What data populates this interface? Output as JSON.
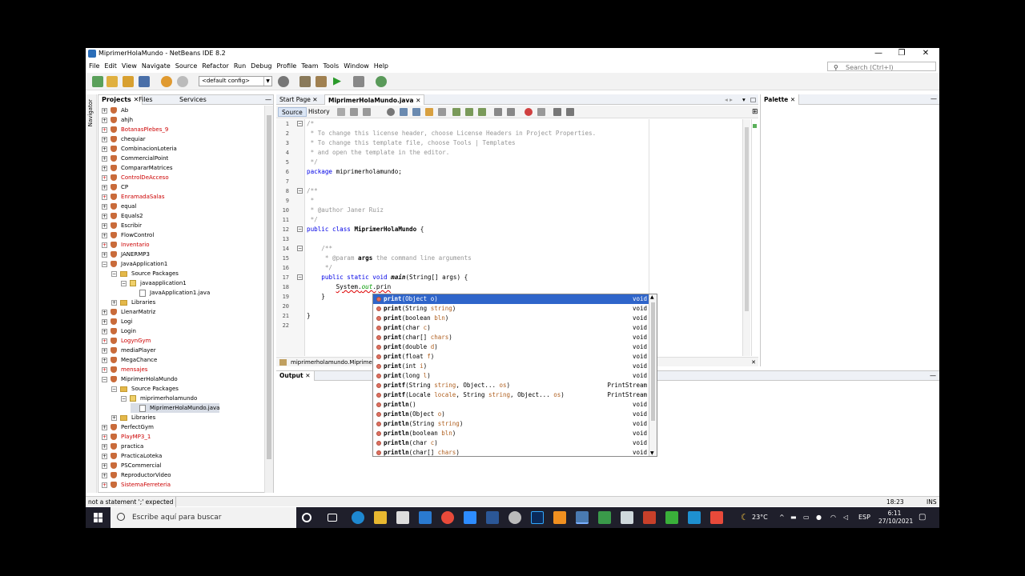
{
  "window": {
    "title": "MiprimerHolaMundo - NetBeans IDE 8.2",
    "minimize": "—",
    "maximize": "❐",
    "close": "✕"
  },
  "menu": [
    "File",
    "Edit",
    "View",
    "Navigate",
    "Source",
    "Refactor",
    "Run",
    "Debug",
    "Profile",
    "Team",
    "Tools",
    "Window",
    "Help"
  ],
  "search": {
    "placeholder": "Search (Ctrl+I)"
  },
  "toolbar": {
    "config": "<default config>"
  },
  "navigator": {
    "label": "Navigator"
  },
  "projects_panel": {
    "tabs": [
      "Projects",
      "Files",
      "Services"
    ],
    "tree": [
      {
        "label": "Ab",
        "level": 0,
        "kind": "project",
        "exp": "+",
        "error": false
      },
      {
        "label": "ahjh",
        "level": 0,
        "kind": "project",
        "exp": "+",
        "error": false
      },
      {
        "label": "BotanasPlebes_9",
        "level": 0,
        "kind": "project",
        "exp": "+",
        "error": true
      },
      {
        "label": "chequiar",
        "level": 0,
        "kind": "project",
        "exp": "+",
        "error": false
      },
      {
        "label": "CombinacionLoteria",
        "level": 0,
        "kind": "project",
        "exp": "+",
        "error": false
      },
      {
        "label": "CommercialPoint",
        "level": 0,
        "kind": "project",
        "exp": "+",
        "error": false
      },
      {
        "label": "CompararMatrices",
        "level": 0,
        "kind": "project",
        "exp": "+",
        "error": false
      },
      {
        "label": "ControlDeAcceso",
        "level": 0,
        "kind": "project",
        "exp": "+",
        "error": true
      },
      {
        "label": "CP",
        "level": 0,
        "kind": "project",
        "exp": "+",
        "error": false
      },
      {
        "label": "EnramadaSalas",
        "level": 0,
        "kind": "project",
        "exp": "+",
        "error": true
      },
      {
        "label": "equal",
        "level": 0,
        "kind": "project",
        "exp": "+",
        "error": false
      },
      {
        "label": "Equals2",
        "level": 0,
        "kind": "project",
        "exp": "+",
        "error": false
      },
      {
        "label": "Escribir",
        "level": 0,
        "kind": "project",
        "exp": "+",
        "error": false
      },
      {
        "label": "FlowControl",
        "level": 0,
        "kind": "project",
        "exp": "+",
        "error": false
      },
      {
        "label": "Inventario",
        "level": 0,
        "kind": "project",
        "exp": "+",
        "error": true
      },
      {
        "label": "JANERMP3",
        "level": 0,
        "kind": "project",
        "exp": "+",
        "error": false
      },
      {
        "label": "JavaApplication1",
        "level": 0,
        "kind": "project",
        "exp": "−",
        "error": false
      },
      {
        "label": "Source Packages",
        "level": 1,
        "kind": "folder",
        "exp": "−",
        "error": false
      },
      {
        "label": "javaapplication1",
        "level": 2,
        "kind": "package",
        "exp": "−",
        "error": false
      },
      {
        "label": "JavaApplication1.java",
        "level": 3,
        "kind": "file",
        "exp": "",
        "error": false
      },
      {
        "label": "Libraries",
        "level": 1,
        "kind": "folder",
        "exp": "+",
        "error": false
      },
      {
        "label": "LlenarMatriz",
        "level": 0,
        "kind": "project",
        "exp": "+",
        "error": false
      },
      {
        "label": "Logi",
        "level": 0,
        "kind": "project",
        "exp": "+",
        "error": false
      },
      {
        "label": "Login",
        "level": 0,
        "kind": "project",
        "exp": "+",
        "error": false
      },
      {
        "label": "LogynGym",
        "level": 0,
        "kind": "project",
        "exp": "+",
        "error": true
      },
      {
        "label": "mediaPlayer",
        "level": 0,
        "kind": "project",
        "exp": "+",
        "error": false
      },
      {
        "label": "MegaChance",
        "level": 0,
        "kind": "project",
        "exp": "+",
        "error": false
      },
      {
        "label": "mensajes",
        "level": 0,
        "kind": "project",
        "exp": "+",
        "error": true
      },
      {
        "label": "MiprimerHolaMundo",
        "level": 0,
        "kind": "project",
        "exp": "−",
        "error": false
      },
      {
        "label": "Source Packages",
        "level": 1,
        "kind": "folder",
        "exp": "−",
        "error": false
      },
      {
        "label": "miprimerholamundo",
        "level": 2,
        "kind": "package",
        "exp": "−",
        "error": false
      },
      {
        "label": "MiprimerHolaMundo.java",
        "level": 3,
        "kind": "file",
        "exp": "",
        "error": false,
        "selected": true
      },
      {
        "label": "Libraries",
        "level": 1,
        "kind": "folder",
        "exp": "+",
        "error": false
      },
      {
        "label": "PerfectGym",
        "level": 0,
        "kind": "project",
        "exp": "+",
        "error": false
      },
      {
        "label": "PlayMP3_1",
        "level": 0,
        "kind": "project",
        "exp": "+",
        "error": true
      },
      {
        "label": "practica",
        "level": 0,
        "kind": "project",
        "exp": "+",
        "error": false
      },
      {
        "label": "PracticaLoteka",
        "level": 0,
        "kind": "project",
        "exp": "+",
        "error": false
      },
      {
        "label": "PSCommercial",
        "level": 0,
        "kind": "project",
        "exp": "+",
        "error": false
      },
      {
        "label": "ReproductorVideo",
        "level": 0,
        "kind": "project",
        "exp": "+",
        "error": false
      },
      {
        "label": "SistemaFerreteria",
        "level": 0,
        "kind": "project",
        "exp": "+",
        "error": true
      }
    ]
  },
  "editor": {
    "tabs": [
      "Start Page",
      "MiprimerHolaMundo.java"
    ],
    "source_btn": "Source",
    "history_btn": "History",
    "breadcrumb": "miprimerholamundo.MiprimerHol",
    "lines": [
      {
        "n": "1",
        "html": "<span class='cm'>/*</span>"
      },
      {
        "n": "2",
        "html": "<span class='cm'> * To change this license header, choose License Headers in Project Properties.</span>"
      },
      {
        "n": "3",
        "html": "<span class='cm'> * To change this template file, choose Tools | Templates</span>"
      },
      {
        "n": "4",
        "html": "<span class='cm'> * and open the template in the editor.</span>"
      },
      {
        "n": "5",
        "html": "<span class='cm'> */</span>"
      },
      {
        "n": "6",
        "html": "<span class='kw'>package</span> miprimerholamundo;"
      },
      {
        "n": "7",
        "html": ""
      },
      {
        "n": "8",
        "html": "<span class='cm'>/**</span>"
      },
      {
        "n": "9",
        "html": "<span class='cm'> *</span>"
      },
      {
        "n": "10",
        "html": "<span class='cm'> * @author Janer Ruiz</span>"
      },
      {
        "n": "11",
        "html": "<span class='cm'> */</span>"
      },
      {
        "n": "12",
        "html": "<span class='kw'>public class</span> <b>MiprimerHolaMundo</b> {"
      },
      {
        "n": "13",
        "html": ""
      },
      {
        "n": "14",
        "html": "    <span class='cm'>/**</span>"
      },
      {
        "n": "15",
        "html": "<span class='cm'>     * @param </span><b>args</b><span class='cm'> the command line arguments</span>"
      },
      {
        "n": "16",
        "html": "<span class='cm'>     */</span>"
      },
      {
        "n": "17",
        "html": "    <span class='kw'>public static void</span> <b><i>main</i></b>(String[] args) {"
      },
      {
        "n": "18",
        "html": "        <span style='text-decoration:underline wavy #d00'>System.<i style='color:#009900'>out</i>.prin</span>"
      },
      {
        "n": "19",
        "html": "    }"
      },
      {
        "n": "20",
        "html": ""
      },
      {
        "n": "21",
        "html": "}"
      },
      {
        "n": "22",
        "html": ""
      }
    ]
  },
  "completion": {
    "items": [
      {
        "name": "print",
        "params": "(Object <span class='pn'>o</span>)",
        "ret": "void"
      },
      {
        "name": "print",
        "params": "(String <span class='pn'>string</span>)",
        "ret": "void"
      },
      {
        "name": "print",
        "params": "(boolean <span class='pn'>bln</span>)",
        "ret": "void"
      },
      {
        "name": "print",
        "params": "(char <span class='pn'>c</span>)",
        "ret": "void"
      },
      {
        "name": "print",
        "params": "(char[] <span class='pn'>chars</span>)",
        "ret": "void"
      },
      {
        "name": "print",
        "params": "(double <span class='pn'>d</span>)",
        "ret": "void"
      },
      {
        "name": "print",
        "params": "(float <span class='pn'>f</span>)",
        "ret": "void"
      },
      {
        "name": "print",
        "params": "(int <span class='pn'>i</span>)",
        "ret": "void"
      },
      {
        "name": "print",
        "params": "(long <span class='pn'>l</span>)",
        "ret": "void"
      },
      {
        "name": "printf",
        "params": "(String <span class='pn'>string</span>, Object... <span class='pn'>os</span>)",
        "ret": "PrintStream"
      },
      {
        "name": "printf",
        "params": "(Locale <span class='pn'>locale</span>, String <span class='pn'>string</span>, Object... <span class='pn'>os</span>)",
        "ret": "PrintStream"
      },
      {
        "name": "println",
        "params": "()",
        "ret": "void"
      },
      {
        "name": "println",
        "params": "(Object <span class='pn'>o</span>)",
        "ret": "void"
      },
      {
        "name": "println",
        "params": "(String <span class='pn'>string</span>)",
        "ret": "void"
      },
      {
        "name": "println",
        "params": "(boolean <span class='pn'>bln</span>)",
        "ret": "void"
      },
      {
        "name": "println",
        "params": "(char <span class='pn'>c</span>)",
        "ret": "void"
      },
      {
        "name": "println",
        "params": "(char[] <span class='pn'>chars</span>)",
        "ret": "void"
      }
    ]
  },
  "output": {
    "title": "Output"
  },
  "palette": {
    "title": "Palette"
  },
  "status": {
    "message": "not a statement  ';' expected",
    "position": "18:23",
    "mode": "INS"
  },
  "taskbar": {
    "search_placeholder": "Escribe aquí para buscar",
    "temperature": "23°C",
    "language": "ESP",
    "time": "6:11",
    "date": "27/10/2021"
  }
}
